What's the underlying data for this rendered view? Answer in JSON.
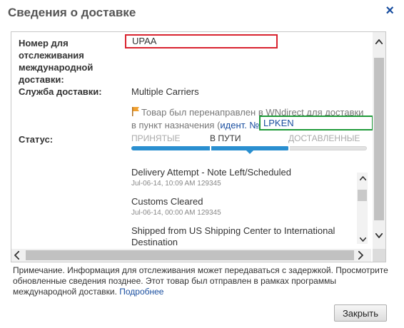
{
  "dialog": {
    "title": "Сведения о доставке",
    "close_glyph": "×"
  },
  "fields": {
    "tracking_label_line1": "Номер для",
    "tracking_label_line2": "отслеживания",
    "tracking_label_line3": "международной",
    "tracking_label_line4": "доставки:",
    "tracking_value": "UPAA",
    "service_label": "Служба доставки:",
    "service_value": "Multiple Carriers",
    "status_label": "Статус:"
  },
  "redirect": {
    "text_line1": "Товар был перенаправлен в WNdirect для доставки",
    "text_line2": "в пункт назначения (",
    "id_label": "идент. №",
    "id_value": "LPKEN"
  },
  "progress": {
    "steps": [
      "ПРИНЯТЫЕ",
      "В ПУТИ",
      "ДОСТАВЛЕННЫЕ"
    ],
    "active_step": "В ПУТИ",
    "fill_fraction": 0.67,
    "colors": {
      "fill": "#2a8fd0",
      "track": "#e2e2e2"
    }
  },
  "events": [
    {
      "title": "Delivery Attempt - Note Left/Scheduled",
      "meta": "Jul-06-14, 10:09 AM 129345"
    },
    {
      "title": "Customs Cleared",
      "meta": "Jul-06-14, 00:00 AM 129345"
    },
    {
      "title": "Shipped from US Shipping Center to International Destination",
      "meta": ""
    }
  ],
  "note": {
    "text": "Примечание. Информация для отслеживания может передаваться с задержкой. Просмотрите обновленные сведения позднее. Этот товар был отправлен в рамках программы международной доставки. ",
    "link": "Подробнее"
  },
  "buttons": {
    "close_label": "Закрыть"
  },
  "icons": {
    "flag": "flag-icon",
    "close": "close-icon",
    "scroll_up": "chevron-up-icon",
    "scroll_down": "chevron-down-icon",
    "scroll_left": "chevron-left-icon",
    "scroll_right": "chevron-right-icon"
  },
  "colors": {
    "link": "#1a4fa0",
    "tracking_box": "#d9232f",
    "id_box": "#1f9a3a",
    "flag": "#f0a030"
  }
}
